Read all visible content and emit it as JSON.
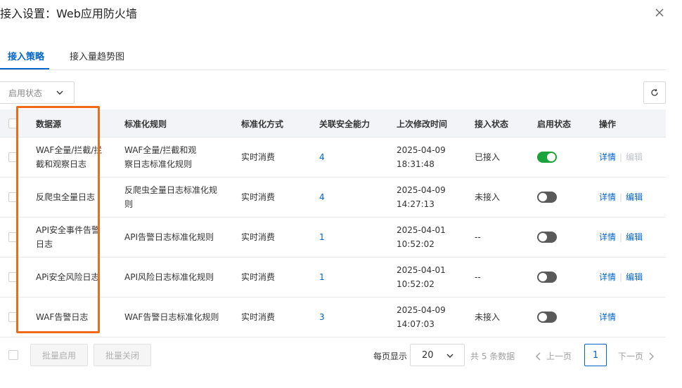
{
  "dialog": {
    "title": "接入设置：Web应用防火墙"
  },
  "tabs": [
    {
      "label": "接入策略",
      "active": true
    },
    {
      "label": "接入量趋势图",
      "active": false
    }
  ],
  "filter": {
    "label": "启用状态"
  },
  "table": {
    "headers": [
      "数据源",
      "标准化规则",
      "标准化方式",
      "关联安全能力",
      "上次修改时间",
      "接入状态",
      "启用状态",
      "操作"
    ],
    "rows": [
      {
        "source": [
          "WAF全量/拦截/拦",
          "截和观察日志"
        ],
        "rule": [
          "WAF全量/拦截和观",
          "察日志标准化规则"
        ],
        "method": "实时消费",
        "capability": "4",
        "modified": [
          "2025-04-09",
          "18:31:48"
        ],
        "access": "已接入",
        "enabled": true,
        "detail": "详情",
        "edit": "编辑",
        "edit_disabled": true
      },
      {
        "source": [
          "反爬虫全量日志"
        ],
        "rule": [
          "反爬虫全量日志标准化规",
          "则"
        ],
        "method": "实时消费",
        "capability": "4",
        "modified": [
          "2025-04-09",
          "14:27:13"
        ],
        "access": "未接入",
        "enabled": false,
        "detail": "详情",
        "edit": "编辑",
        "edit_disabled": false
      },
      {
        "source": [
          "API安全事件告警",
          "日志"
        ],
        "rule": [
          "API告警日志标准化规则"
        ],
        "method": "实时消费",
        "capability": "1",
        "modified": [
          "2025-04-01",
          "10:52:02"
        ],
        "access": "--",
        "enabled": false,
        "detail": "详情",
        "edit": "编辑",
        "edit_disabled": false
      },
      {
        "source": [
          "APi安全风险日志"
        ],
        "rule": [
          "API风险日志标准化规则"
        ],
        "method": "实时消费",
        "capability": "1",
        "modified": [
          "2025-04-01",
          "10:52:02"
        ],
        "access": "--",
        "enabled": false,
        "detail": "详情",
        "edit": "编辑",
        "edit_disabled": false
      },
      {
        "source": [
          "WAF告警日志"
        ],
        "rule": [
          "WAF告警日志标准化规则"
        ],
        "method": "实时消费",
        "capability": "3",
        "modified": [
          "2025-04-09",
          "14:07:03"
        ],
        "access": "未接入",
        "enabled": false,
        "detail": "详情",
        "edit": "",
        "edit_disabled": false
      }
    ]
  },
  "footer": {
    "batch_enable": "批量启用",
    "batch_close": "批量关闭",
    "per_page_label": "每页显示",
    "page_size": "20",
    "total": "共 5 条数据",
    "prev": "上一页",
    "current_page": "1",
    "next": "下一页"
  },
  "colors": {
    "accent": "#0064c8",
    "toggle_on": "#1aa33a",
    "highlight": "#f06a1a"
  }
}
